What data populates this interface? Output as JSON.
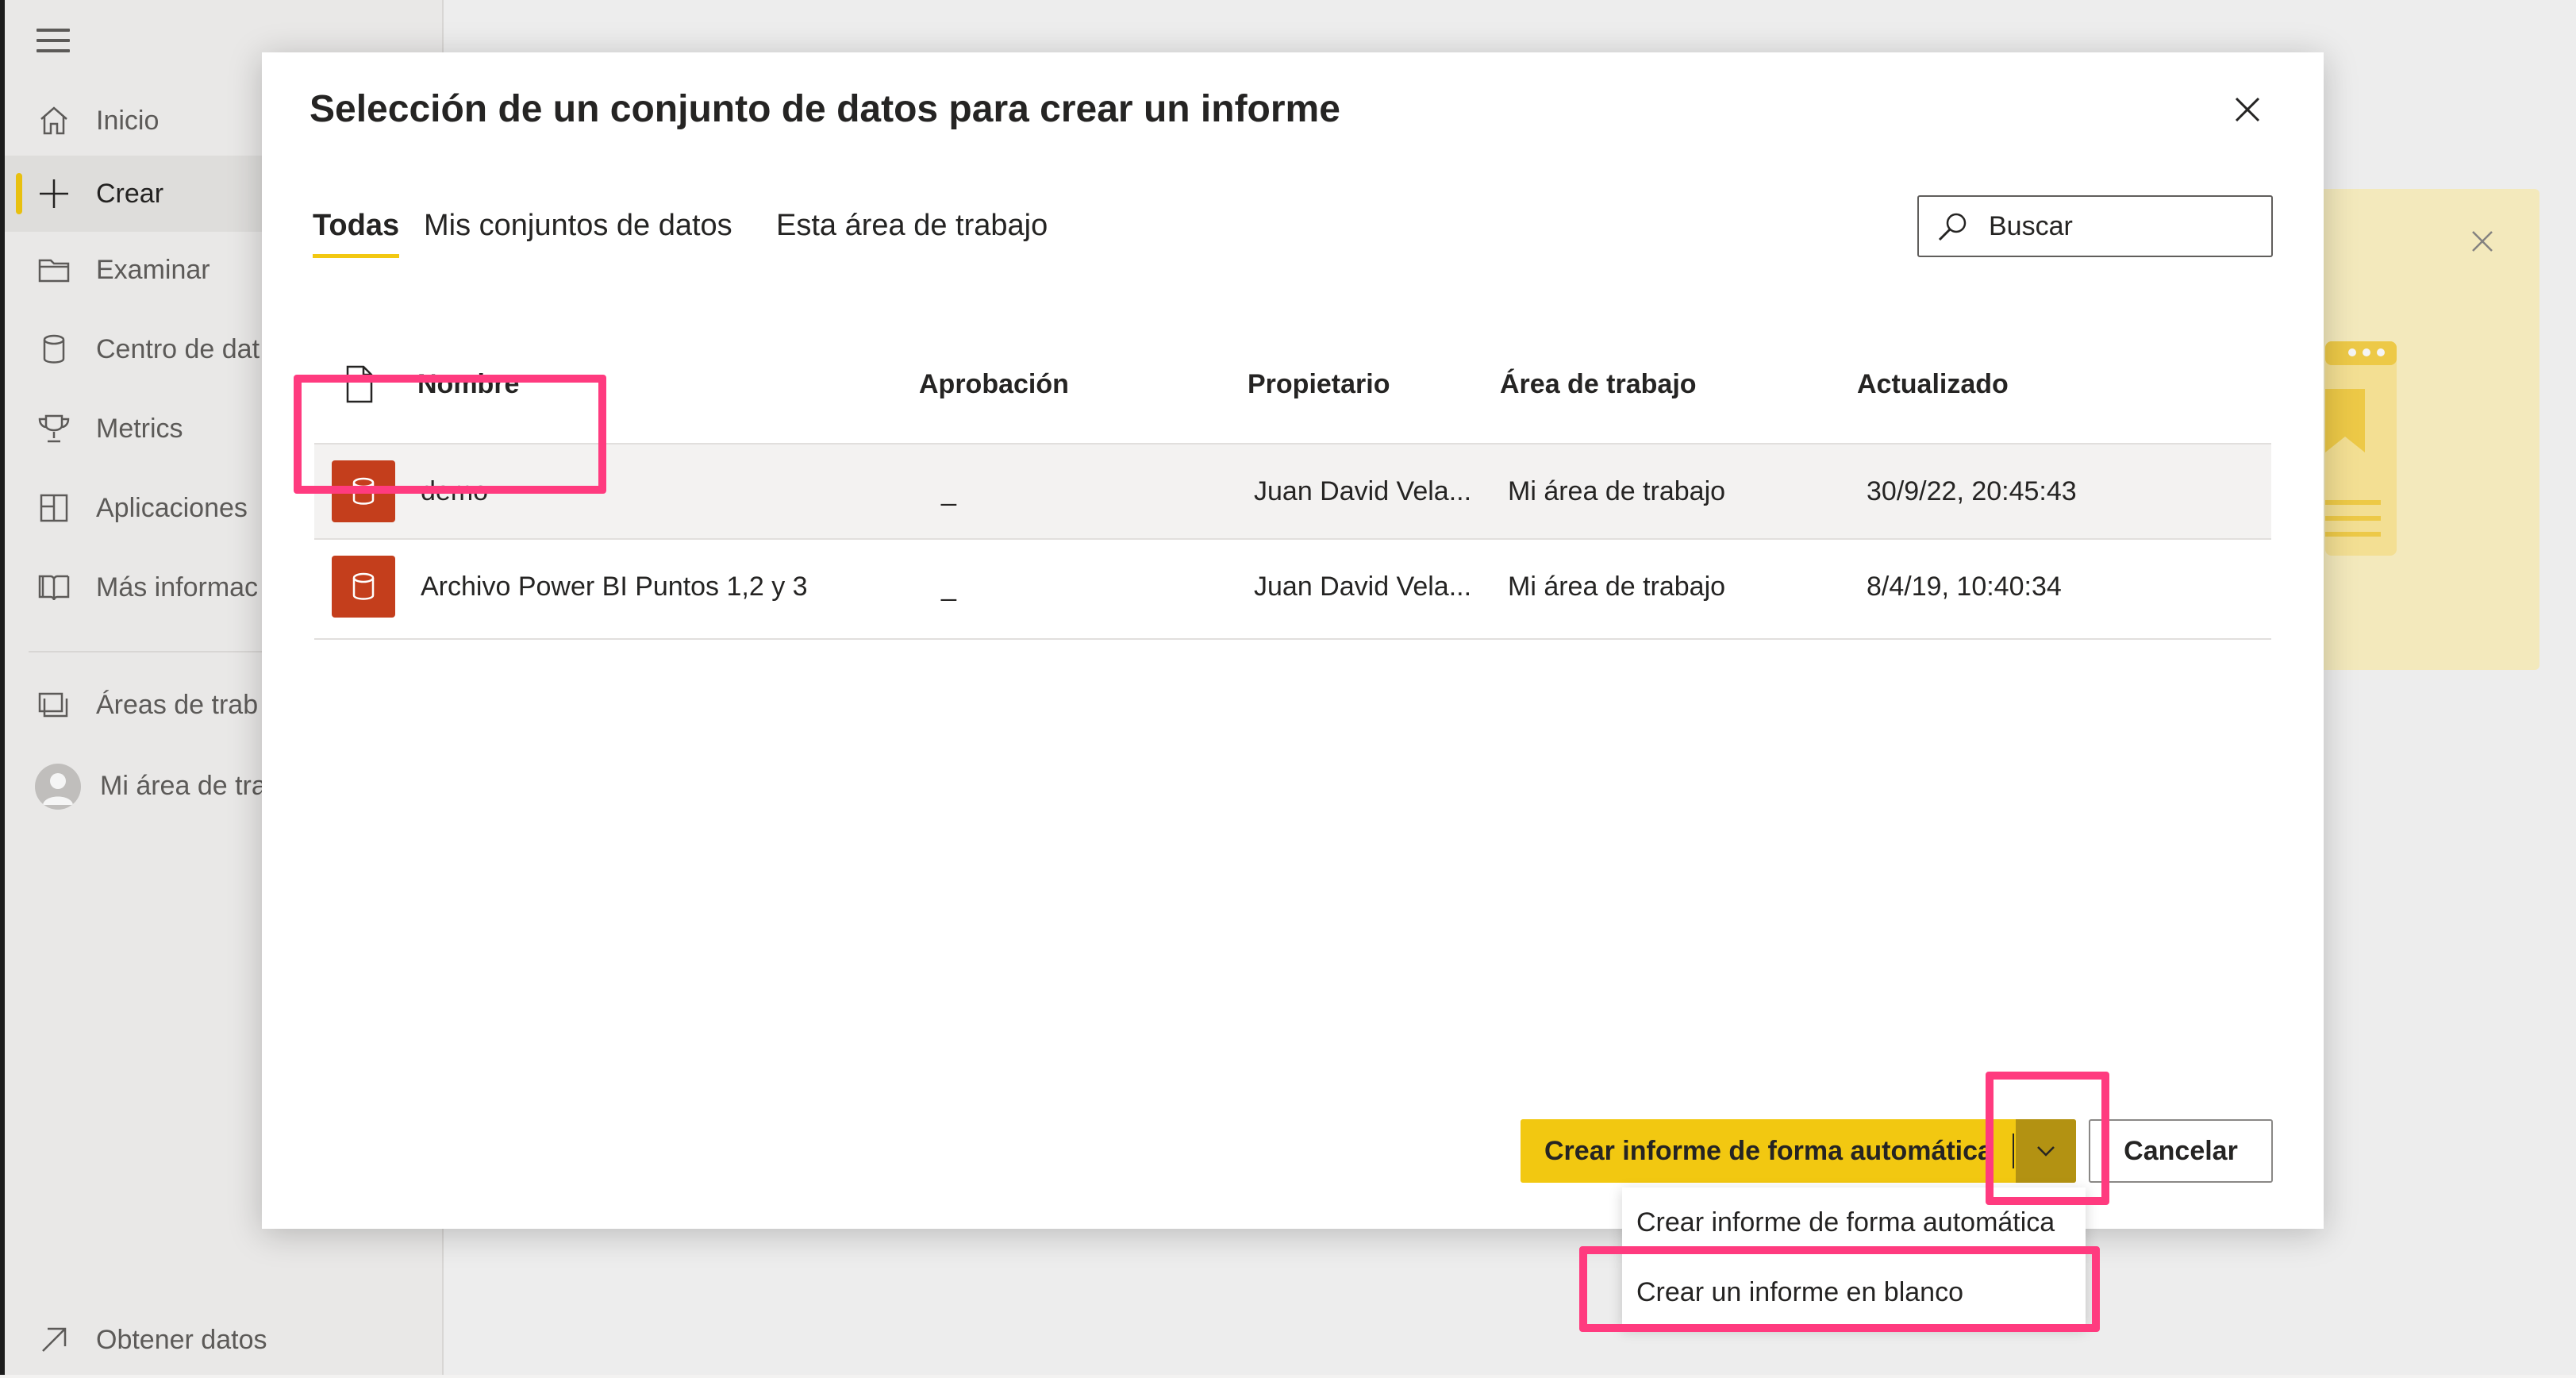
{
  "sidebar": {
    "items": [
      {
        "label": "Inicio",
        "icon": "home-icon"
      },
      {
        "label": "Crear",
        "icon": "plus-icon",
        "active": true
      },
      {
        "label": "Examinar",
        "icon": "folder-icon"
      },
      {
        "label": "Centro de dat",
        "icon": "database-icon"
      },
      {
        "label": "Metrics",
        "icon": "trophy-icon"
      },
      {
        "label": "Aplicaciones",
        "icon": "apps-icon"
      },
      {
        "label": "Más informac",
        "icon": "book-icon"
      },
      {
        "label": "Áreas de trab",
        "icon": "workspaces-icon"
      },
      {
        "label": "Mi área de tra",
        "icon": "avatar"
      }
    ],
    "get_data": "Obtener datos"
  },
  "dialog": {
    "title": "Selección de un conjunto de datos para crear un informe",
    "tabs": [
      "Todas",
      "Mis conjuntos de datos",
      "Esta área de trabajo"
    ],
    "active_tab": "Todas",
    "search_placeholder": "Buscar",
    "columns": [
      "Nombre",
      "Aprobación",
      "Propietario",
      "Área de trabajo",
      "Actualizado"
    ],
    "rows": [
      {
        "name": "demo",
        "approval": "_",
        "owner": "Juan David Vela...",
        "workspace": "Mi área de trabajo",
        "updated": "30/9/22, 20:45:43",
        "selected": true
      },
      {
        "name": "Archivo Power BI Puntos 1,2 y 3",
        "approval": "_",
        "owner": "Juan David Vela...",
        "workspace": "Mi área de trabajo",
        "updated": "8/4/19, 10:40:34",
        "selected": false
      }
    ],
    "primary_button": "Crear informe de forma automática",
    "cancel_button": "Cancelar",
    "menu_items": [
      "Crear informe de forma automática",
      "Crear un informe en blanco"
    ]
  },
  "colors": {
    "accent": "#f2c811",
    "accent_dark": "#b39212",
    "dataset_icon": "#c43e1c",
    "highlight": "#ff3b7f"
  }
}
